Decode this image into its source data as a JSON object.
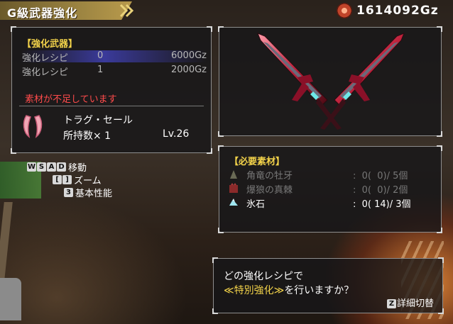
{
  "header": {
    "title": "G級武器強化",
    "money": "1614092Gz"
  },
  "left_panel": {
    "section_label": "【強化武器】",
    "recipes": [
      {
        "name": "強化レシピ",
        "index": "0",
        "price": "6000Gz"
      },
      {
        "name": "強化レシピ",
        "index": "1",
        "price": "2000Gz"
      }
    ],
    "warning": "素材が不足しています",
    "material": {
      "name": "トラグ・セール",
      "owned": "所持数× 1",
      "level": "Lv.26"
    }
  },
  "controls": {
    "move": {
      "keys": [
        "W",
        "S",
        "A",
        "D"
      ],
      "label": "移動"
    },
    "zoom": {
      "keys": [
        "[",
        "]"
      ],
      "label": "ズーム"
    },
    "stats": {
      "keys": [
        "3"
      ],
      "label": "基本性能"
    }
  },
  "required": {
    "section_label": "【必要素材】",
    "items": [
      {
        "name": "角竜の牡牙",
        "quantity": ":  0(  0)/ 5個",
        "icon": "horn-icon",
        "available": false
      },
      {
        "name": "爆狼の真棘",
        "quantity": ":  0(  0)/ 2個",
        "icon": "spike-icon",
        "available": false
      },
      {
        "name": "氷石",
        "quantity": ":  0( 14)/ 3個",
        "icon": "ice-stone-icon",
        "available": true
      }
    ]
  },
  "dialog": {
    "line1": "どの強化レシピで",
    "line2_highlight": "≪特別強化≫",
    "line2_rest": "を行いますか？",
    "toggle_key": "Z",
    "toggle_label": "詳細切替"
  },
  "colors": {
    "accent_yellow": "#f2d24a",
    "warning_red": "#ff4b4b",
    "selection_blue": "#3a3a9a"
  }
}
